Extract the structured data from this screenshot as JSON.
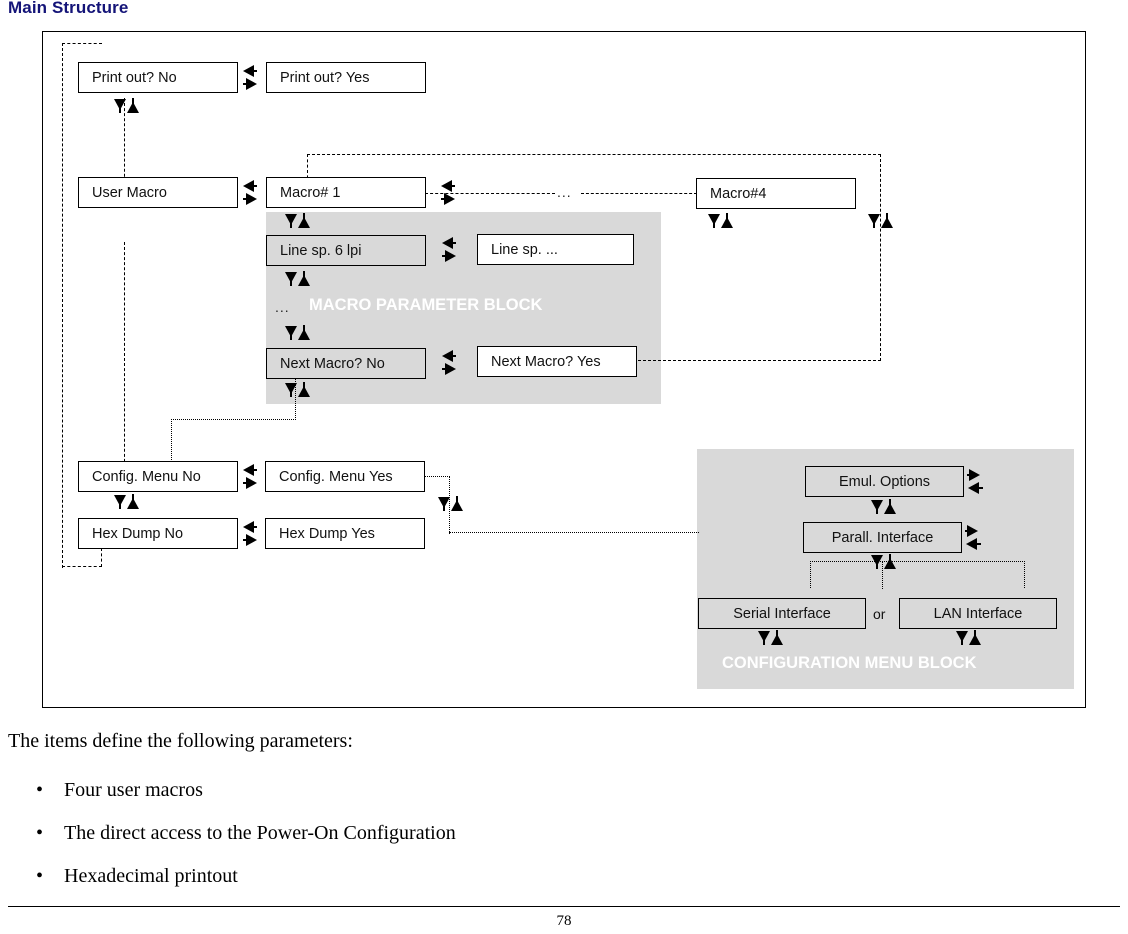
{
  "title": "Main Structure",
  "diagram": {
    "boxes": {
      "print_out_no": "Print out? No",
      "print_out_yes": "Print out? Yes",
      "user_macro": "User Macro",
      "macro_1": "Macro# 1",
      "macro_4": "Macro#4",
      "line_sp_6lpi": "Line sp. 6 lpi",
      "line_sp_more": "Line sp. ...",
      "next_macro_no": "Next Macro? No",
      "next_macro_yes": "Next Macro? Yes",
      "config_menu_no": "Config. Menu No",
      "config_menu_yes": "Config. Menu  Yes",
      "hex_dump_no": "Hex Dump No",
      "hex_dump_yes": "Hex Dump  Yes",
      "emul_options": "Emul. Options",
      "parall_interface": "Parall. Interface",
      "serial_interface": "Serial Interface",
      "lan_interface": "LAN Interface"
    },
    "labels": {
      "macro_param_block": "MACRO PARAMETER BLOCK",
      "config_menu_block": "CONFIGURATION MENU BLOCK",
      "ellipsis_macro_params": "...",
      "ellipsis_macro_chain": "...",
      "or": "or"
    },
    "colors": {
      "block_fill": "#d9d9d9",
      "block_label_text": "#ffffff",
      "box_border": "#000000",
      "title": "#141478"
    }
  },
  "body": {
    "intro": "The items define the following parameters:",
    "bullet_glyph": "•",
    "bullets": [
      "Four user macros",
      "The direct access to the Power-On Configuration",
      "Hexadecimal printout"
    ]
  },
  "footer": {
    "page_number": "78"
  }
}
